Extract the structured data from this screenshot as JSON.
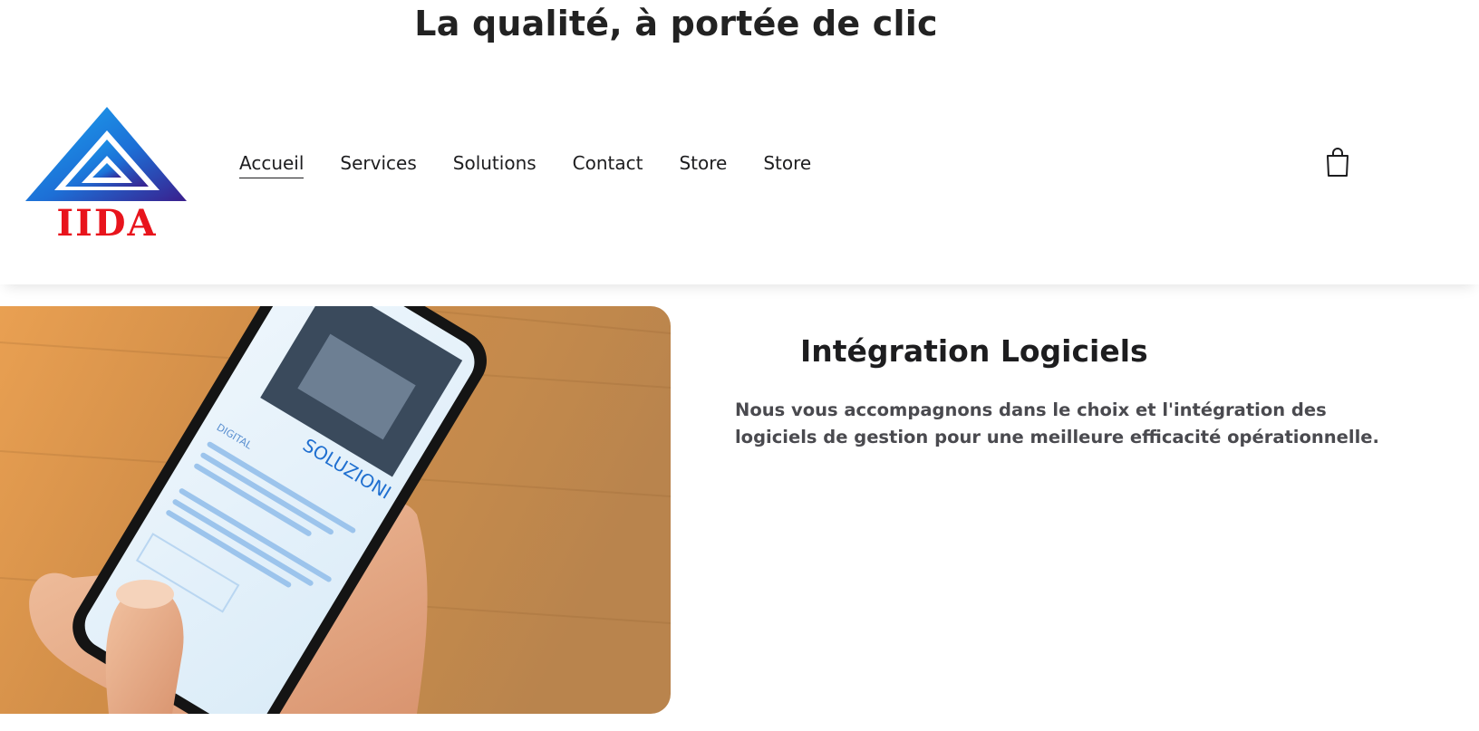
{
  "page": {
    "tagline": "La qualité, à portée de clic"
  },
  "header": {
    "logo_text": "IIDA",
    "nav": [
      {
        "label": "Accueil",
        "active": true
      },
      {
        "label": "Services",
        "active": false
      },
      {
        "label": "Solutions",
        "active": false
      },
      {
        "label": "Contact",
        "active": false
      },
      {
        "label": "Store",
        "active": false
      },
      {
        "label": "Store",
        "active": false
      }
    ],
    "cart_icon": "shopping-bag-icon"
  },
  "hero": {
    "phone_screen_heading": "SOLUZIONI",
    "phone_screen_label": "DIGITAL"
  },
  "service": {
    "title": "Intégration Logiciels",
    "description": "Nous vous accompagnons dans le choix et l'intégration des logiciels de gestion pour une meilleure efficacité opérationnelle."
  },
  "colors": {
    "logo_blue_light": "#1a9be8",
    "logo_blue_dark": "#3a1e8c",
    "logo_red": "#e8141c",
    "text_dark": "#1d1d1f",
    "text_muted": "#4a4a4f",
    "wood": "#c98a45"
  }
}
